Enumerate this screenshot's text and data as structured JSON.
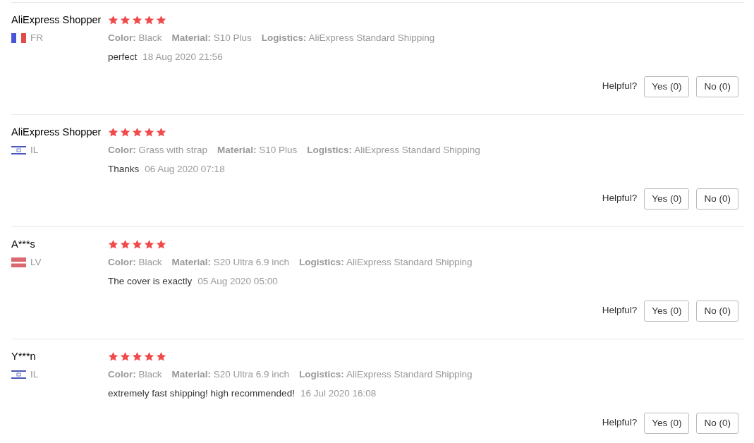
{
  "reviews": [
    {
      "user": "AliExpress Shopper",
      "flag": {
        "kind": "fr"
      },
      "country": "FR",
      "stars": 5,
      "attributes": [
        {
          "label": "Color:",
          "value": "Black"
        },
        {
          "label": "Material:",
          "value": "S10 Plus"
        },
        {
          "label": "Logistics:",
          "value": "AliExpress Standard Shipping"
        }
      ],
      "comment": "perfect",
      "date": "18 Aug 2020 21:56",
      "helpful_label": "Helpful?",
      "yes": "Yes (0)",
      "no": "No (0)"
    },
    {
      "user": "AliExpress Shopper",
      "flag": {
        "kind": "il"
      },
      "country": "IL",
      "stars": 5,
      "attributes": [
        {
          "label": "Color:",
          "value": "Grass with strap"
        },
        {
          "label": "Material:",
          "value": "S10 Plus"
        },
        {
          "label": "Logistics:",
          "value": "AliExpress Standard Shipping"
        }
      ],
      "comment": "Thanks",
      "date": "06 Aug 2020 07:18",
      "helpful_label": "Helpful?",
      "yes": "Yes (0)",
      "no": "No (0)"
    },
    {
      "user": "A***s",
      "flag": {
        "kind": "lv"
      },
      "country": "LV",
      "stars": 5,
      "attributes": [
        {
          "label": "Color:",
          "value": "Black"
        },
        {
          "label": "Material:",
          "value": "S20 Ultra 6.9 inch"
        },
        {
          "label": "Logistics:",
          "value": "AliExpress Standard Shipping"
        }
      ],
      "comment": "The cover is exactly",
      "date": "05 Aug 2020 05:00",
      "helpful_label": "Helpful?",
      "yes": "Yes (0)",
      "no": "No (0)"
    },
    {
      "user": "Y***n",
      "flag": {
        "kind": "il"
      },
      "country": "IL",
      "stars": 5,
      "attributes": [
        {
          "label": "Color:",
          "value": "Black"
        },
        {
          "label": "Material:",
          "value": "S20 Ultra 6.9 inch"
        },
        {
          "label": "Logistics:",
          "value": "AliExpress Standard Shipping"
        }
      ],
      "comment": "extremely fast shipping! high recommended!",
      "date": "16 Jul 2020 16:08",
      "helpful_label": "Helpful?",
      "yes": "Yes (0)",
      "no": "No (0)"
    }
  ]
}
